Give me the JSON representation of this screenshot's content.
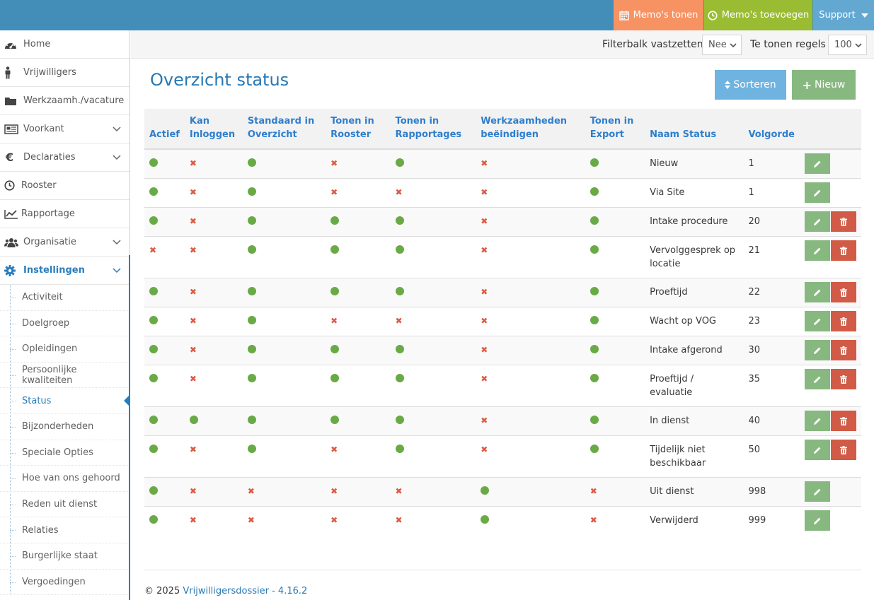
{
  "topbar": {
    "memo_show": "Memo's tonen",
    "memo_add": "Memo's toevoegen",
    "support": "Support",
    "colors": {
      "bar": "#438eb9",
      "memo_show": "#f79263",
      "memo_add": "#9abc32",
      "support": "#62a8d1"
    }
  },
  "sidebar": {
    "items": [
      {
        "label": "Home",
        "icon": "tachometer-icon"
      },
      {
        "label": "Vrijwilligers",
        "icon": "male-icon"
      },
      {
        "label": "Werkzaamh./vacature",
        "icon": "folder-icon"
      },
      {
        "label": "Voorkant",
        "icon": "newspaper-icon"
      },
      {
        "label": "Declaraties",
        "icon": "euro-icon"
      },
      {
        "label": "Rooster",
        "icon": "clock-icon"
      },
      {
        "label": "Rapportage",
        "icon": "line-chart-icon"
      },
      {
        "label": "Organisatie",
        "icon": "users-icon"
      },
      {
        "label": "Instellingen",
        "icon": "gear-icon"
      }
    ],
    "submenu": [
      "Activiteit",
      "Doelgroep",
      "Opleidingen",
      "Persoonlijke kwaliteiten",
      "Status",
      "Bijzonderheden",
      "Speciale Opties",
      "Hoe van ons gehoord",
      "Reden uit dienst",
      "Relaties",
      "Burgerlijke staat",
      "Vergoedingen"
    ]
  },
  "filterbar": {
    "pin_label": "Filterbalk vastzetten",
    "pin_value": "Nee",
    "rows_label": "Te tonen regels",
    "rows_value": "100"
  },
  "main": {
    "title": "Overzicht status",
    "sort_button": "Sorteren",
    "new_button": "Nieuw"
  },
  "table": {
    "headers": [
      "Actief",
      "Kan Inloggen",
      "Standaard in Overzicht",
      "Tonen in Rooster",
      "Tonen in Rapportages",
      "Werkzaamheden beëindigen",
      "Tonen in Export",
      "Naam Status",
      "Volgorde"
    ],
    "rows": [
      {
        "flags": [
          1,
          0,
          1,
          0,
          1,
          0,
          1
        ],
        "name": "Nieuw",
        "order": "1",
        "deletable": false
      },
      {
        "flags": [
          1,
          0,
          1,
          0,
          0,
          0,
          1
        ],
        "name": "Via Site",
        "order": "1",
        "deletable": false
      },
      {
        "flags": [
          1,
          0,
          1,
          1,
          1,
          0,
          1
        ],
        "name": "Intake procedure",
        "order": "20",
        "deletable": true
      },
      {
        "flags": [
          0,
          0,
          1,
          1,
          1,
          0,
          1
        ],
        "name": "Vervolggesprek op locatie",
        "order": "21",
        "deletable": true
      },
      {
        "flags": [
          1,
          0,
          1,
          1,
          1,
          0,
          1
        ],
        "name": "Proeftijd",
        "order": "22",
        "deletable": true
      },
      {
        "flags": [
          1,
          0,
          1,
          0,
          0,
          0,
          1
        ],
        "name": "Wacht op VOG",
        "order": "23",
        "deletable": true
      },
      {
        "flags": [
          1,
          0,
          1,
          1,
          1,
          0,
          1
        ],
        "name": "Intake afgerond",
        "order": "30",
        "deletable": true
      },
      {
        "flags": [
          1,
          0,
          1,
          1,
          1,
          0,
          1
        ],
        "name": "Proeftijd / evaluatie",
        "order": "35",
        "deletable": true
      },
      {
        "flags": [
          1,
          1,
          1,
          1,
          1,
          0,
          1
        ],
        "name": "In dienst",
        "order": "40",
        "deletable": true
      },
      {
        "flags": [
          1,
          0,
          1,
          0,
          1,
          0,
          1
        ],
        "name": "Tijdelijk niet beschikbaar",
        "order": "50",
        "deletable": true
      },
      {
        "flags": [
          1,
          0,
          0,
          0,
          0,
          1,
          0
        ],
        "name": "Uit dienst",
        "order": "998",
        "deletable": false
      },
      {
        "flags": [
          1,
          0,
          0,
          0,
          0,
          1,
          0
        ],
        "name": "Verwijderd",
        "order": "999",
        "deletable": false
      }
    ],
    "colors": {
      "yes": "#69aa46",
      "no": "#dd5a43",
      "edit": "#87b87f",
      "delete": "#d15b47"
    }
  },
  "footer": {
    "copyright": "© 2025",
    "link": "Vrijwilligersdossier - 4.16.2"
  }
}
